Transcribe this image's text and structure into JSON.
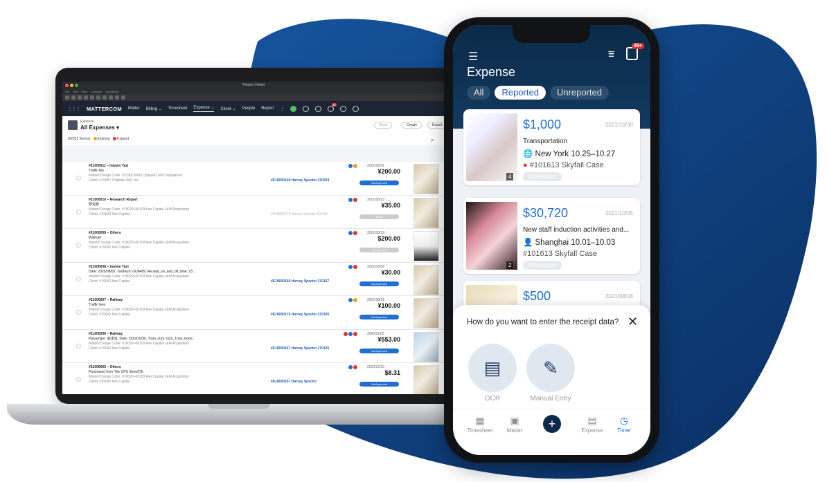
{
  "laptop": {
    "window_title": "Picture Viewer",
    "menu": [
      "File",
      "Edit",
      "View",
      "Compare",
      "Annotation"
    ],
    "nav": {
      "brand": "MATTERCOM",
      "links": [
        "Matter",
        "Billing ⌄",
        "Timesheet",
        "Expense ⌄",
        "Client ⌄",
        "People",
        "Report",
        "⋮"
      ],
      "active": "Expense ⌄",
      "notify_count": "12"
    },
    "header": {
      "section": "Expense",
      "view": "All Expenses ▾",
      "count": "80/312 Item(s)",
      "expiring": "Expiring",
      "expired": "Expired",
      "buttons": [
        "Move",
        "Create",
        "Export"
      ]
    },
    "rows": [
      {
        "title": "#21000011 – Intown Taxi",
        "vendor": "Traffic fee",
        "matter": "Matter/Charge Code: #2190C0003 Chipotle Grill Compliance",
        "client": "Client: #19051 Chipotle Grill, Inc.",
        "link": "#E18000168 Harvey Specter 210204",
        "date": "2021/08/31",
        "amount": "¥200.00",
        "status": "1st Approved"
      },
      {
        "title": "#21000010 – Research Report",
        "vendor": "研究费",
        "matter": "Matter/Charge Code: #19029–00103 Axe Capital L&M Acquisition",
        "client": "Client: #19042 Axe Capital",
        "link": "#E18000178 Harvey Specter 210115",
        "date": "2021/08/23",
        "amount": "¥35.00",
        "status": "Draft"
      },
      {
        "title": "#21000009 – Others",
        "vendor": "Walmart",
        "matter": "Matter/Charge Code: #19029–00103 Axe Capital L&M Acquisition",
        "client": "Client: #19042 Axe Capital",
        "link": "",
        "date": "2021/08/19",
        "amount": "$200.00",
        "status": "Unreported"
      },
      {
        "title": "#21000008 – Intown Taxi",
        "vendor": "Date:  2020/08/05,  TaxiNum:  GU8489,  Receipt_on_and_off_time:  23:…",
        "matter": "Matter/Charge Code: #19029–00103 Axe Capital L&M Acquisition",
        "client": "Client: #19042 Axe Capital",
        "link": "#E18000168 Harvey Specter 210127",
        "date": "2021/08/08",
        "amount": "¥30.00",
        "status": "1st Approved"
      },
      {
        "title": "#21000007 – Railway",
        "vendor": "Traffic fees",
        "matter": "Matter/Charge Code: #19029–00103 Axe Capital L&M Acquisition",
        "client": "Client: #19042 Axe Capital",
        "link": "#E18000174 Harvey Specter 210326",
        "date": "2021/08/31",
        "amount": "¥100.00",
        "status": "1st Approved"
      },
      {
        "title": "#21000006 – Railway",
        "vendor": "Passenger: 高達宝,  Date:  2019/10/30,  Train_num:  G22,  Train_ticket…",
        "matter": "Matter/Charge Code: #19029–00103 Axe Capital L&M Acquisition",
        "client": "Client: #19042 Axe Capital",
        "link": "#E18000167 Harvey Specter 210126",
        "date": "2020/11/05",
        "amount": "¥553.00",
        "status": "1st Approved"
      },
      {
        "title": "#21000005 – Others",
        "vendor": "Purchased from The UPS Store(I)®",
        "matter": "Matter/Charge Code: #19029–00103 Axe Capital L&M Acquisition",
        "client": "Client: #19042 Axe Capital",
        "link": "#E18000167 Harvey Specter",
        "date": "2020/12/10",
        "amount": "$8.31",
        "status": "1st Approved"
      }
    ]
  },
  "phone": {
    "title": "Expense",
    "badge": "99+",
    "tabs": [
      "All",
      "Reported",
      "Unreported"
    ],
    "active_tab": "Reported",
    "cards": [
      {
        "amount": "$1,000",
        "date": "2021/10/30",
        "category": "Transportation",
        "trip": "New York 10.25–10.27",
        "case": "#101613 Skyfall Case",
        "status": "Unreported",
        "photos": "4"
      },
      {
        "amount": "$30,720",
        "date": "2021/10/05",
        "category": "New staff induction activities and...",
        "trip": "Shanghai 10.01–10.03",
        "case": "#101613 Skyfall Case",
        "status": "Unreported",
        "photos": "2"
      },
      {
        "amount": "$500",
        "date": "2021/08/28"
      }
    ],
    "sheet": {
      "question": "How do you want to enter the receipt data?",
      "options": [
        "OCR",
        "Manual Entry"
      ]
    },
    "tabbar": [
      "Timesheet",
      "Matter",
      "",
      "Expense",
      "Timer"
    ],
    "active_tabbar": "Timer"
  },
  "colors": {
    "accent": "#1e6fd1",
    "navy": "#0b2a48",
    "blob": "#0f4d93",
    "expiring": "#f0a020",
    "expired": "#e2342f"
  }
}
